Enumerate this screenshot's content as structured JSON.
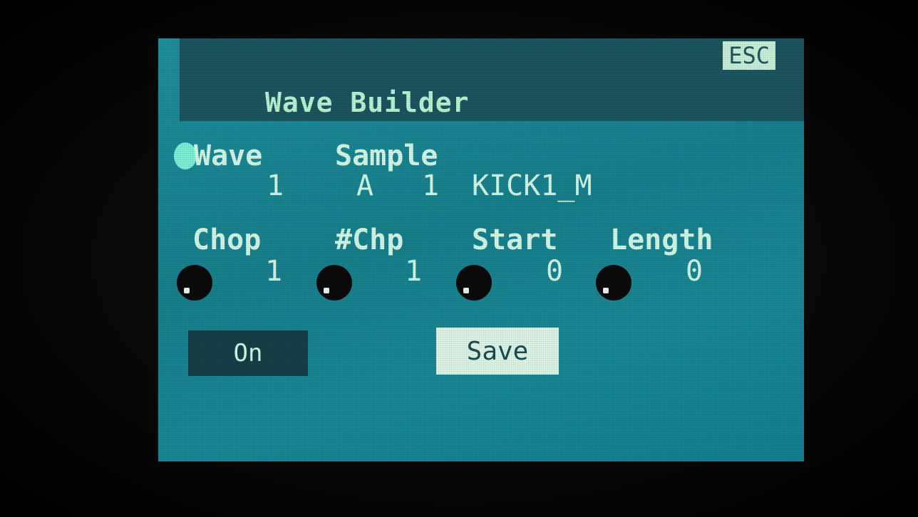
{
  "header": {
    "title": "Wave Builder",
    "esc_label": "ESC"
  },
  "row1": {
    "wave": {
      "label": "Wave",
      "value": "1"
    },
    "sample": {
      "label": "Sample",
      "bank": "A",
      "number": "1",
      "name": "KICK1_M"
    }
  },
  "row2": {
    "chop": {
      "label": "Chop",
      "value": "1"
    },
    "num_chops": {
      "label": "#Chp",
      "value": "1"
    },
    "start": {
      "label": "Start",
      "value": "0"
    },
    "length": {
      "label": "Length",
      "value": "0"
    }
  },
  "buttons": {
    "on_label": "On",
    "save_label": "Save"
  },
  "colors": {
    "screen": "#1a8592",
    "header": "#1c5560",
    "text": "#d3f8e6",
    "highlight": "#dff5e8"
  }
}
